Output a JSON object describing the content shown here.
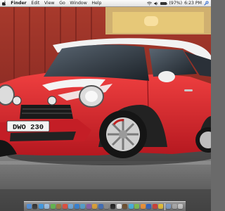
{
  "menubar": {
    "apple_icon": "apple-logo-icon",
    "items": [
      {
        "label": "Finder"
      },
      {
        "label": "Edit"
      },
      {
        "label": "View"
      },
      {
        "label": "Go"
      },
      {
        "label": "Window"
      },
      {
        "label": "Help"
      }
    ],
    "status": {
      "battery_text": "(97%)",
      "battery_level": 0.97,
      "time": "6:23 PM",
      "icons": [
        "wifi-icon",
        "volume-icon",
        "battery-icon",
        "spotlight-icon"
      ]
    }
  },
  "wallpaper": {
    "description_icon": "wallpaper-image",
    "license_plate": "DWO 230",
    "colors": {
      "car_body": "#d7252c",
      "roof": "#f4f4f4",
      "wall": "#9a2a24",
      "road": "#5c5c5c"
    }
  },
  "dock": {
    "items": [
      {
        "name": "finder-icon",
        "color": "#4a8fe0"
      },
      {
        "name": "dashboard-icon",
        "color": "#303030"
      },
      {
        "name": "safari-icon",
        "color": "#3b9ae8"
      },
      {
        "name": "mail-icon",
        "color": "#9ec3e8"
      },
      {
        "name": "ichat-icon",
        "color": "#5fb84a"
      },
      {
        "name": "address-book-icon",
        "color": "#a0763c"
      },
      {
        "name": "ical-icon",
        "color": "#e44a3a"
      },
      {
        "name": "preview-icon",
        "color": "#6ca9df"
      },
      {
        "name": "itunes-icon",
        "color": "#2f7fd5"
      },
      {
        "name": "iphoto-icon",
        "color": "#4f9fcf"
      },
      {
        "name": "imovie-icon",
        "color": "#8a5aa8"
      },
      {
        "name": "garageband-icon",
        "color": "#e0a030"
      },
      {
        "name": "quicktime-icon",
        "color": "#3a6ab8"
      },
      {
        "name": "system-preferences-icon",
        "color": "#8a8a8a"
      },
      {
        "name": "terminal-icon",
        "color": "#1c1c1c"
      },
      {
        "name": "textedit-icon",
        "color": "#e8e8e8"
      },
      {
        "name": "chess-icon",
        "color": "#6a4a2a"
      },
      {
        "name": "itunes-store-icon",
        "color": "#3fb3e3"
      },
      {
        "name": "app-icon-green",
        "color": "#7cc04a"
      },
      {
        "name": "app-icon-orange",
        "color": "#f09030"
      },
      {
        "name": "app-icon-blue",
        "color": "#2a5fc0"
      },
      {
        "name": "app-icon-red",
        "color": "#d03a30"
      },
      {
        "name": "app-icon-yellow",
        "color": "#e8c030"
      }
    ],
    "right_items": [
      {
        "name": "downloads-stack-icon",
        "color": "#7a9ac8"
      },
      {
        "name": "documents-stack-icon",
        "color": "#a8a8a8"
      },
      {
        "name": "trash-icon",
        "color": "#c8c8c8"
      }
    ]
  }
}
